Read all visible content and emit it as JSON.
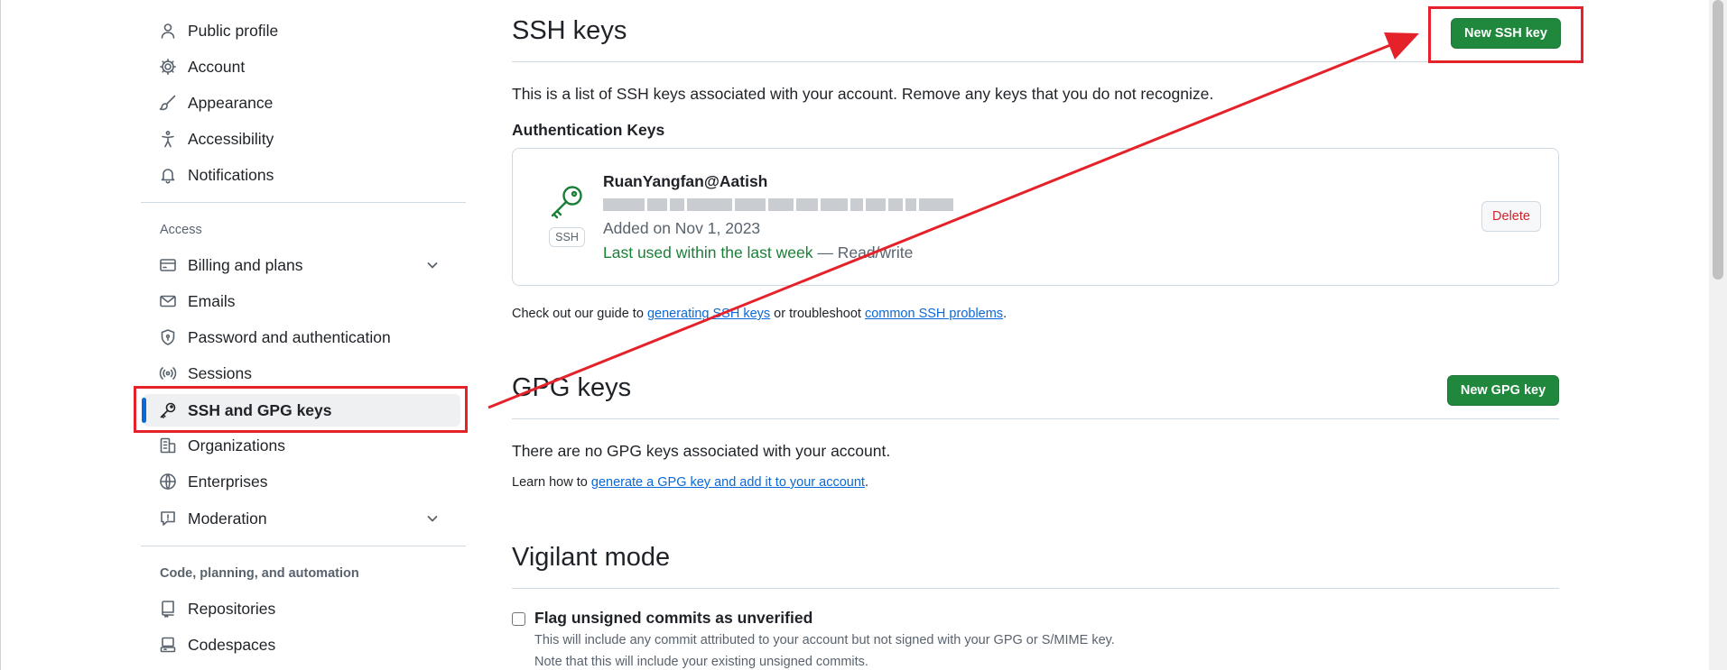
{
  "sidebar": {
    "items_top": [
      {
        "label": "Public profile",
        "icon": "person-icon"
      },
      {
        "label": "Account",
        "icon": "gear-icon"
      },
      {
        "label": "Appearance",
        "icon": "paintbrush-icon"
      },
      {
        "label": "Accessibility",
        "icon": "accessibility-icon"
      },
      {
        "label": "Notifications",
        "icon": "bell-icon"
      }
    ],
    "access_heading": "Access",
    "items_access": [
      {
        "label": "Billing and plans",
        "icon": "credit-card-icon"
      },
      {
        "label": "Emails",
        "icon": "mail-icon"
      },
      {
        "label": "Password and authentication",
        "icon": "shield-lock-icon"
      },
      {
        "label": "Sessions",
        "icon": "broadcast-icon"
      },
      {
        "label": "SSH and GPG keys",
        "icon": "key-icon"
      },
      {
        "label": "Organizations",
        "icon": "organization-icon"
      },
      {
        "label": "Enterprises",
        "icon": "globe-icon"
      },
      {
        "label": "Moderation",
        "icon": "report-icon"
      }
    ],
    "code_heading": "Code, planning, and automation",
    "items_code": [
      {
        "label": "Repositories",
        "icon": "repo-icon"
      },
      {
        "label": "Codespaces",
        "icon": "codespaces-icon"
      }
    ]
  },
  "ssh": {
    "title": "SSH keys",
    "new_button": "New SSH key",
    "description": "This is a list of SSH keys associated with your account. Remove any keys that you do not recognize.",
    "auth_heading": "Authentication Keys",
    "key": {
      "name": "RuanYangfan@Aatish",
      "type_label": "SSH",
      "added": "Added on Nov 1, 2023",
      "last_used": "Last used within the last week",
      "access": " — Read/write",
      "delete_label": "Delete"
    },
    "guide_prefix": "Check out our guide to ",
    "guide_link1": "generating SSH keys",
    "guide_middle": " or troubleshoot ",
    "guide_link2": "common SSH problems",
    "guide_suffix": "."
  },
  "gpg": {
    "title": "GPG keys",
    "new_button": "New GPG key",
    "empty": "There are no GPG keys associated with your account.",
    "learn_prefix": "Learn how to ",
    "learn_link": "generate a GPG key and add it to your account",
    "learn_suffix": "."
  },
  "vigilant": {
    "title": "Vigilant mode",
    "checkbox_label": "Flag unsigned commits as unverified",
    "help1": "This will include any commit attributed to your account but not signed with your GPG or S/MIME key.",
    "help2": "Note that this will include your existing unsigned commits.",
    "checked": false
  },
  "colors": {
    "accent": "#0969da",
    "primary_button": "#1f883d",
    "annotation": "#e5222a",
    "success": "#1a7f37",
    "danger": "#d1242f"
  }
}
